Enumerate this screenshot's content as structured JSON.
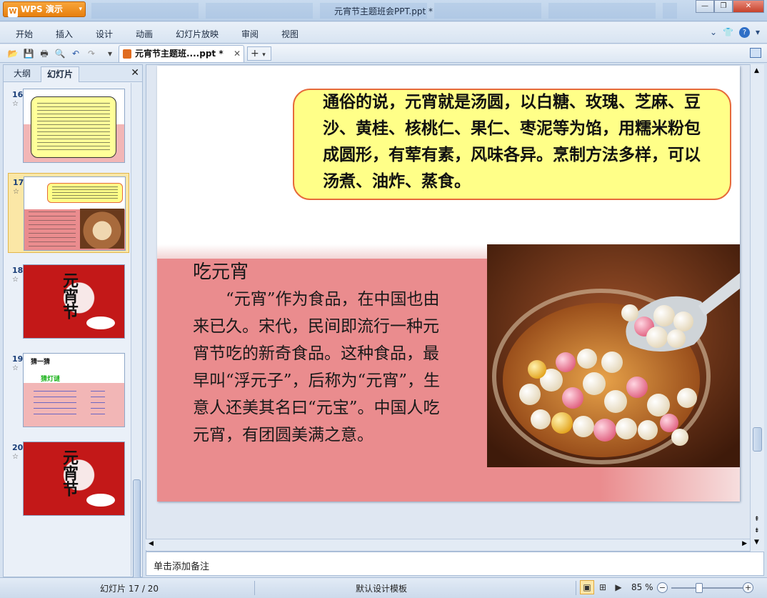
{
  "app": {
    "name": "WPS 演示",
    "logo": "W"
  },
  "window": {
    "title": "元宵节主题班会PPT.ppt *"
  },
  "menu": [
    "开始",
    "插入",
    "设计",
    "动画",
    "幻灯片放映",
    "审阅",
    "视图"
  ],
  "document_tab": {
    "label": "元宵节主题班....ppt *"
  },
  "panel": {
    "tabs": [
      "大纲",
      "幻灯片"
    ],
    "active_tab": "幻灯片"
  },
  "thumbnails": [
    {
      "number": "16",
      "star": "☆",
      "title": ""
    },
    {
      "number": "17",
      "star": "☆",
      "title": "吃元宵",
      "selected": true
    },
    {
      "number": "18",
      "star": "☆",
      "title": "元宵节"
    },
    {
      "number": "19",
      "star": "☆",
      "title": "猜一猜",
      "subtitle": "猜灯谜"
    },
    {
      "number": "20",
      "star": "☆",
      "title": "元宵节"
    }
  ],
  "slide": {
    "callout": "通俗的说，元宵就是汤圆，以白糖、玫瑰、芝麻、豆沙、黄桂、核桃仁、果仁、枣泥等为馅，用糯米粉包成圆形，有荤有素，风味各异。烹制方法多样，可以汤煮、油炸、蒸食。",
    "section_title": "吃元宵",
    "body": "“元宵”作为食品，在中国也由来已久。宋代，民间即流行一种元宵节吃的新奇食品。这种食品，最早叫“浮元子”，后称为“元宵”，生意人还美其名曰“元宝”。中国人吃元宵，有团圆美满之意。"
  },
  "notes": {
    "placeholder": "单击添加备注"
  },
  "status": {
    "slide_counter": "幻灯片 17 / 20",
    "template": "默认设计模板",
    "zoom": "85 %"
  },
  "colors": {
    "accent": "#e7800f",
    "callout_fill": "#ffff88",
    "callout_border": "#e66a3a",
    "band": "#ea8c8e"
  }
}
